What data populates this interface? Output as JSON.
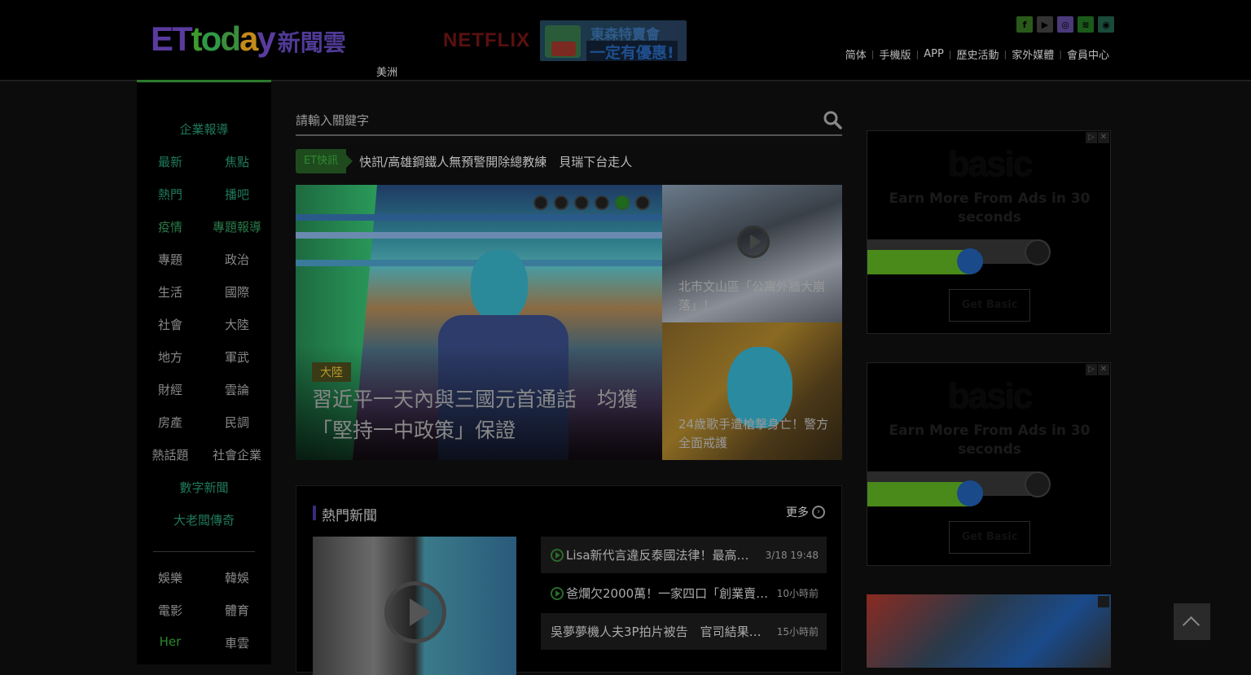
{
  "header": {
    "logo_et": "ET",
    "logo_t": "t",
    "logo_cn": "新聞雲",
    "region": "美洲",
    "netflix": "NETFLIX",
    "promo_line1": "東森特賣會",
    "promo_line2": "一定有優惠!",
    "social": [
      {
        "icon": "facebook-icon",
        "glyph": "f",
        "color": "#2a5a1a"
      },
      {
        "icon": "youtube-icon",
        "glyph": "▶",
        "color": "#333333"
      },
      {
        "icon": "instagram-icon",
        "glyph": "◎",
        "color": "#4a3a7a"
      },
      {
        "icon": "rss-icon",
        "glyph": "≋",
        "color": "#1a5a1a"
      },
      {
        "icon": "line-icon",
        "glyph": "◉",
        "color": "#1a4a3a"
      }
    ],
    "topnav": [
      "简体",
      "手機版",
      "APP",
      "歷史活動",
      "家外媒體",
      "會員中心"
    ]
  },
  "sidebar": {
    "rows": [
      {
        "items": [
          "企業報導"
        ],
        "color": "#1f7a5a"
      },
      {
        "items": [
          "最新",
          "焦點"
        ],
        "color": "#1f7a5a"
      },
      {
        "items": [
          "熱門",
          "播吧"
        ],
        "color": "#1f7a5a"
      },
      {
        "items": [
          "疫情",
          "專題報導"
        ],
        "color": "#2a7a4a"
      },
      {
        "items": [
          "專題",
          "政治"
        ],
        "color": "#888888"
      },
      {
        "items": [
          "生活",
          "國際"
        ],
        "color": "#888888"
      },
      {
        "items": [
          "社會",
          "大陸"
        ],
        "color": "#888888"
      },
      {
        "items": [
          "地方",
          "軍武"
        ],
        "color": "#888888"
      },
      {
        "items": [
          "財經",
          "雲論"
        ],
        "color": "#888888"
      },
      {
        "items": [
          "房產",
          "民調"
        ],
        "color": "#888888"
      },
      {
        "items": [
          "熱話題",
          "社會企業"
        ],
        "color": "#888888"
      },
      {
        "items": [
          "數字新聞"
        ],
        "color": "#1f7a5a"
      },
      {
        "items": [
          "大老闆傳奇"
        ],
        "color": "#1f7a5a"
      },
      {
        "items": [
          "娛樂",
          "韓娛"
        ],
        "color": "#888888"
      },
      {
        "items": [
          "電影",
          "體育"
        ],
        "color": "#888888"
      },
      {
        "items": [
          "Her",
          "車雲"
        ],
        "color": "#888888",
        "first_color": "#2a8a2a"
      }
    ]
  },
  "search": {
    "placeholder": "請輸入關鍵字"
  },
  "flash": {
    "tag": "ET快訊",
    "text": "快訊/高雄鋼鐵人無預警開除總教練　貝瑞下台走人"
  },
  "carousel": {
    "main": {
      "category": "大陸",
      "title": "習近平一天內與三國元首通話　均獲「堅持一中政策」保證"
    },
    "dot_count": 6,
    "active_dot": 4,
    "side1": "北市文山區「公寓外牆大崩落」！",
    "side2": "24歲歌手遭槍擊身亡！警方全面戒護"
  },
  "hot_news": {
    "title": "熱門新聞",
    "more": "更多",
    "items": [
      {
        "text": "Lisa新代言違反泰國法律！最高「…",
        "time": "3/18 19:48",
        "video": true
      },
      {
        "text": "爸爛欠2000萬！一家四口「創業賣…",
        "time": "10小時前",
        "video": true
      },
      {
        "text": "吳夢夢機人夫3P拍片被告　官司結果…",
        "time": "15小時前",
        "video": false
      }
    ]
  },
  "ads": {
    "brand": "basic",
    "tagline": "Earn More From Ads in 30 seconds",
    "button": "Get Basic",
    "progress": 0.57
  }
}
